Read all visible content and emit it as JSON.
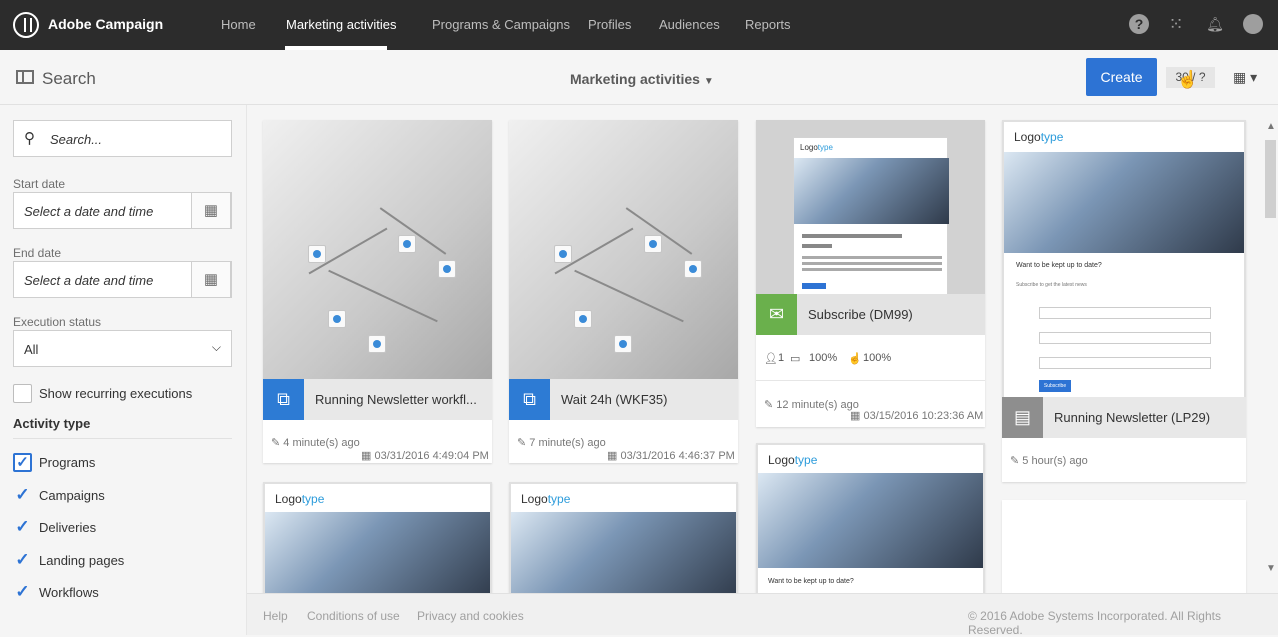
{
  "app": {
    "brand": "Adobe Campaign",
    "nav": [
      "Home",
      "Marketing activities",
      "Programs & Campaigns",
      "Profiles",
      "Audiences",
      "Reports"
    ]
  },
  "toolbar": {
    "search_title": "Search",
    "view_title": "Marketing activities",
    "create_label": "Create",
    "pager": "30 / ?"
  },
  "sidebar": {
    "search_placeholder": "Search...",
    "start_date_label": "Start date",
    "start_date_placeholder": "Select a date and time",
    "end_date_label": "End date",
    "end_date_placeholder": "Select a date and time",
    "execution_status_label": "Execution status",
    "execution_status_value": "All",
    "show_recurring": "Show recurring executions",
    "activity_type_title": "Activity type",
    "activity_types": [
      "Programs",
      "Campaigns",
      "Deliveries",
      "Landing pages",
      "Workflows"
    ]
  },
  "cards": [
    {
      "title": "Running Newsletter workfl...",
      "edited": "4 minute(s) ago",
      "date": "03/31/2016 4:49:04 PM"
    },
    {
      "title": "Wait 24h (WKF35)",
      "edited": "7 minute(s) ago",
      "date": "03/31/2016 4:46:37 PM"
    },
    {
      "title": "Subscribe (DM99)",
      "recipients": "1",
      "stat1": "100%",
      "stat2": "100%",
      "edited": "12 minute(s) ago",
      "date": "03/15/2016 10:23:36 AM"
    },
    {
      "title": "Running Newsletter (LP29)",
      "edited": "5 hour(s) ago",
      "lp_heading": "Want to be kept up to date?",
      "lp_sub": "Subscribe to get the latest news",
      "lp_button": "Subscribe"
    }
  ],
  "preview": {
    "logo_a": "Logo",
    "logo_b": "type",
    "question": "Want to be kept up to date?"
  },
  "footer": {
    "links": [
      "Help",
      "Conditions of use",
      "Privacy and cookies"
    ],
    "copyright": "© 2016 Adobe Systems Incorporated. All Rights Reserved."
  },
  "colors": {
    "accent": "#2d73d4",
    "email": "#6ab04c",
    "workflow": "#2d7bd4",
    "landing": "#8e8e8e"
  },
  "icons": [
    "logo-icon",
    "help-icon",
    "apps-icon",
    "bell-icon",
    "avatar-icon",
    "panel-icon",
    "chevron-down-icon",
    "grid-view-icon",
    "search-icon",
    "calendar-icon",
    "workflow-icon",
    "email-icon",
    "landing-page-icon",
    "pencil-icon",
    "calendar-small-icon",
    "user-icon",
    "hand-cursor-icon"
  ]
}
